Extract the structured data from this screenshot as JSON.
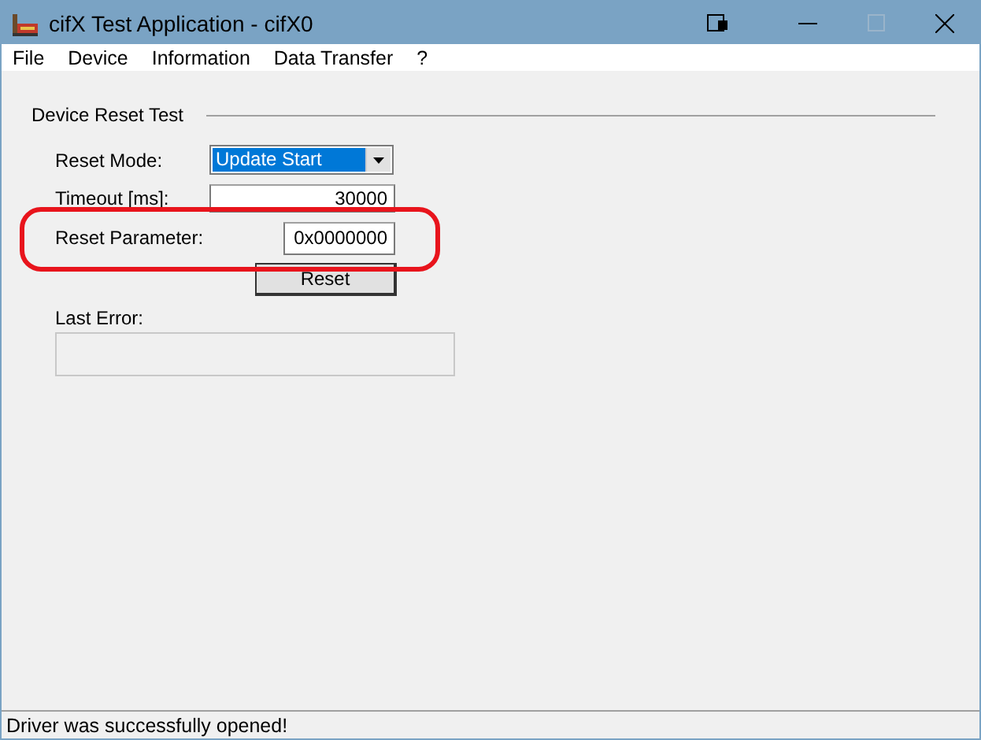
{
  "window": {
    "title": "cifX Test Application - cifX0"
  },
  "menu": [
    "File",
    "Device",
    "Information",
    "Data Transfer",
    "?"
  ],
  "group": {
    "title": "Device Reset Test"
  },
  "form": {
    "reset_mode": {
      "label": "Reset Mode:",
      "value": "Update Start"
    },
    "timeout": {
      "label": "Timeout [ms]:",
      "value": "30000"
    },
    "reset_parameter": {
      "label": "Reset Parameter:",
      "value": "0x0000000"
    },
    "reset_button": "Reset",
    "last_error": {
      "label": "Last Error:"
    }
  },
  "status_bar": "Driver was successfully opened!"
}
